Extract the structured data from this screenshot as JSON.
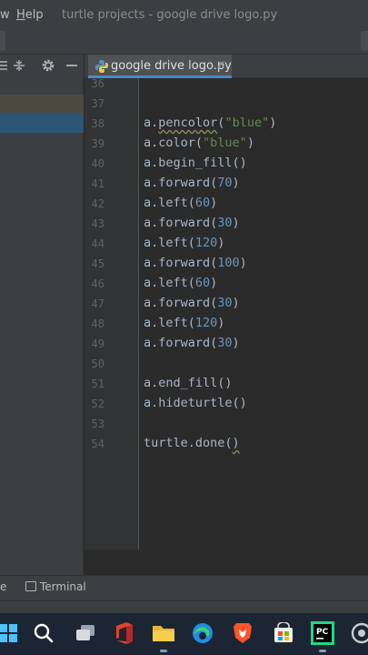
{
  "menu": {
    "partial_item": "w",
    "help_underlined": "H",
    "help_rest": "elp"
  },
  "window_title": "turtle projects - google drive logo.py",
  "editor_tab": {
    "label": "google drive logo.py",
    "close": "×"
  },
  "project_toolbar": {
    "collapse_icon": "⇔",
    "settings_icon": "⚙",
    "hide_icon": "—"
  },
  "lines": [
    {
      "n": "36",
      "code": ""
    },
    {
      "n": "37",
      "code": ""
    },
    {
      "n": "38",
      "code": "a.pencolor(\"blue\")"
    },
    {
      "n": "39",
      "code": "a.color(\"blue\")"
    },
    {
      "n": "40",
      "code": "a.begin_fill()"
    },
    {
      "n": "41",
      "code": "a.forward(70)"
    },
    {
      "n": "42",
      "code": "a.left(60)"
    },
    {
      "n": "43",
      "code": "a.forward(30)"
    },
    {
      "n": "44",
      "code": "a.left(120)"
    },
    {
      "n": "45",
      "code": "a.forward(100)"
    },
    {
      "n": "46",
      "code": "a.left(60)"
    },
    {
      "n": "47",
      "code": "a.forward(30)"
    },
    {
      "n": "48",
      "code": "a.left(120)"
    },
    {
      "n": "49",
      "code": "a.forward(30)"
    },
    {
      "n": "50",
      "code": ""
    },
    {
      "n": "51",
      "code": "a.end_fill()"
    },
    {
      "n": "52",
      "code": "a.hideturtle()"
    },
    {
      "n": "53",
      "code": ""
    },
    {
      "n": "54",
      "code": "turtle.done()"
    }
  ],
  "bottom_bar": {
    "partial_item": "e",
    "terminal_label": "Terminal"
  },
  "taskbar": {
    "apps": [
      "windows-start-icon",
      "search-icon",
      "task-view-icon",
      "office-icon",
      "file-explorer-icon",
      "edge-icon",
      "brave-icon",
      "store-icon",
      "pycharm-icon",
      "settings-icon"
    ],
    "pycharm_badge": "PC"
  },
  "colors": {
    "editor_bg": "#2b2b2b",
    "keyword": "#a9b7c6",
    "number": "#6897bb",
    "string": "#6a8759",
    "tab_underline": "#4a88c7",
    "selection": "#2d5576"
  }
}
